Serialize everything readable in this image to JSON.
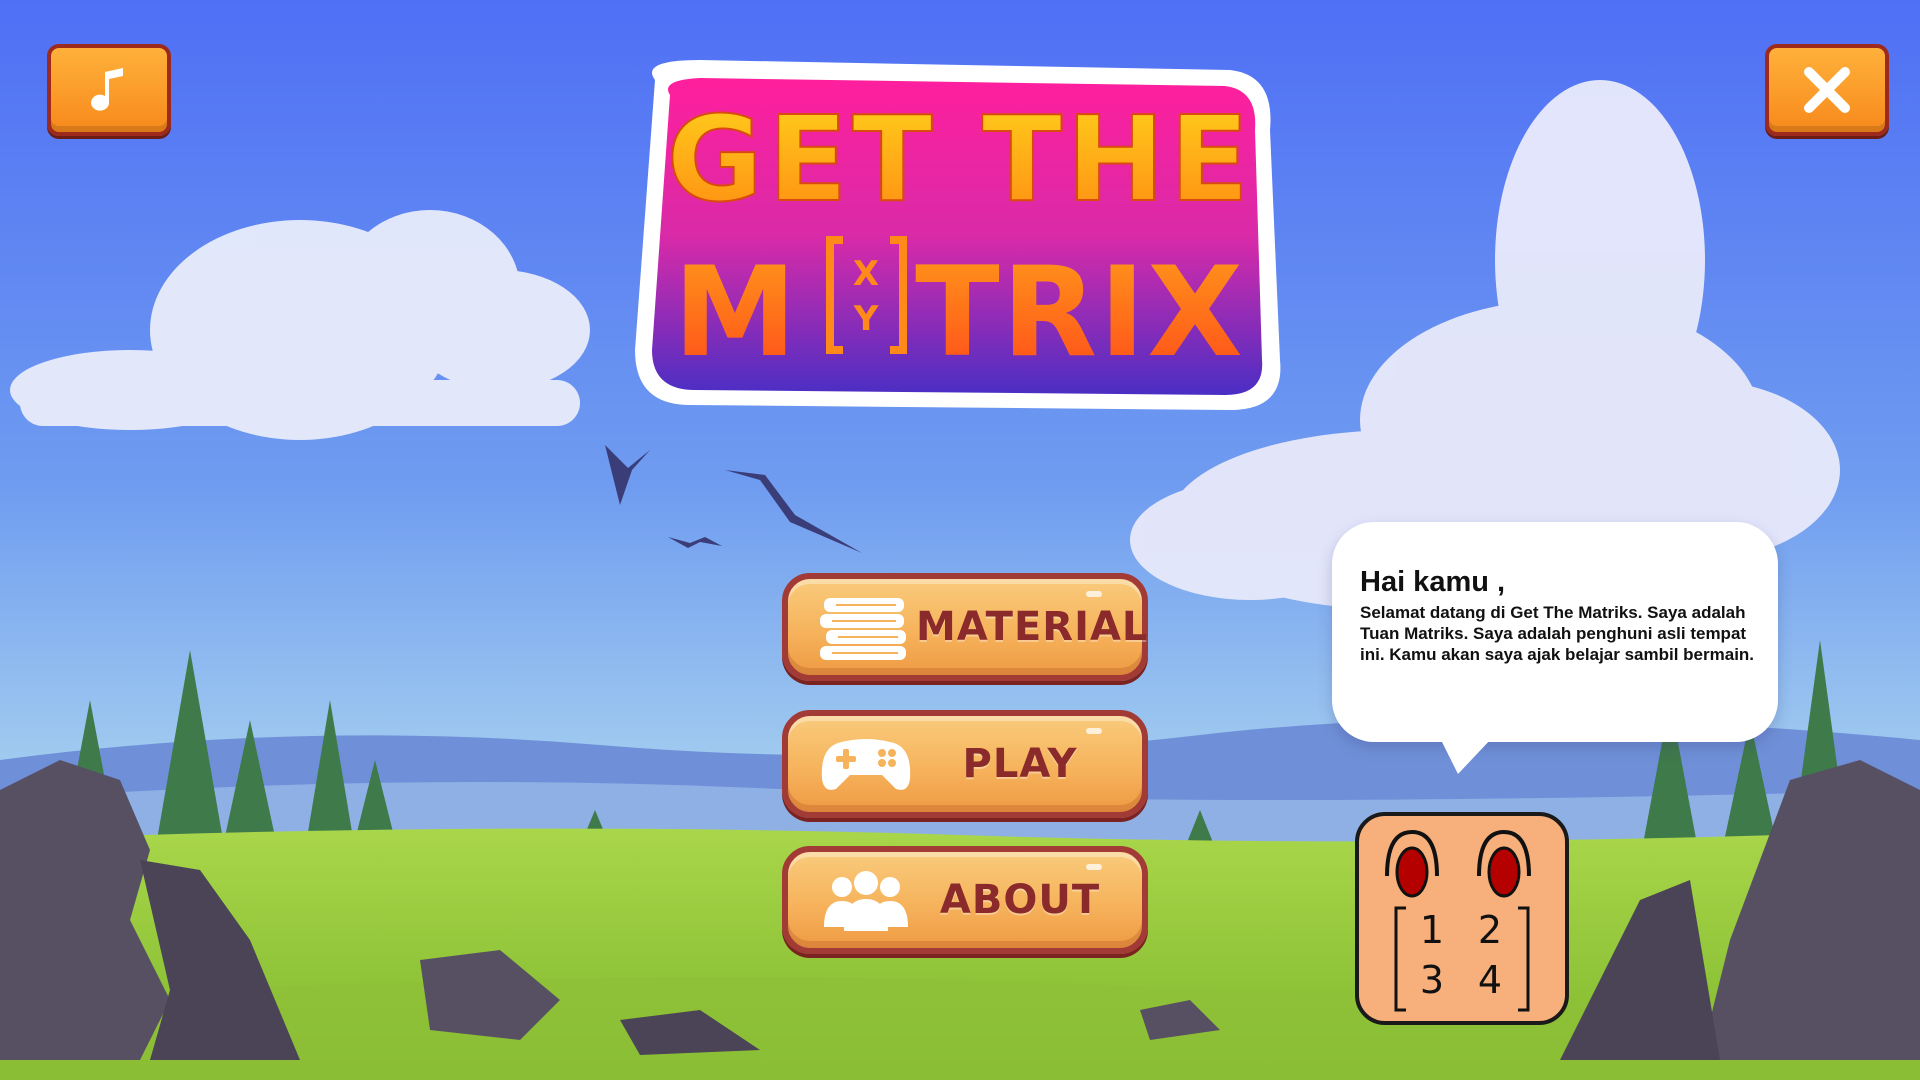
{
  "game": {
    "title_line1": "GET THE",
    "title_line2_start": "M",
    "title_line2_end": "TRIX",
    "logo_bracket_top": "X",
    "logo_bracket_bottom": "Y"
  },
  "toolbar": {
    "music_icon": "music-note-icon",
    "close_icon": "close-x-icon"
  },
  "menu": {
    "items": [
      {
        "label": "MATERIAL",
        "icon": "books-icon"
      },
      {
        "label": "PLAY",
        "icon": "gamepad-icon"
      },
      {
        "label": "ABOUT",
        "icon": "group-icon"
      }
    ]
  },
  "dialog": {
    "greeting": "Hai kamu ,",
    "message": "Selamat datang di Get The Matriks. Saya adalah Tuan Matriks. Saya adalah penghuni asli tempat ini. Kamu akan saya ajak belajar sambil bermain."
  },
  "mascot": {
    "matrix": [
      [
        "1",
        "2"
      ],
      [
        "3",
        "4"
      ]
    ]
  },
  "colors": {
    "button_orange": "#f7891c",
    "button_border": "#9e2a1e",
    "menu_text": "#8a2a2a",
    "mascot_body": "#f7b07c",
    "eye_red": "#b50000"
  }
}
